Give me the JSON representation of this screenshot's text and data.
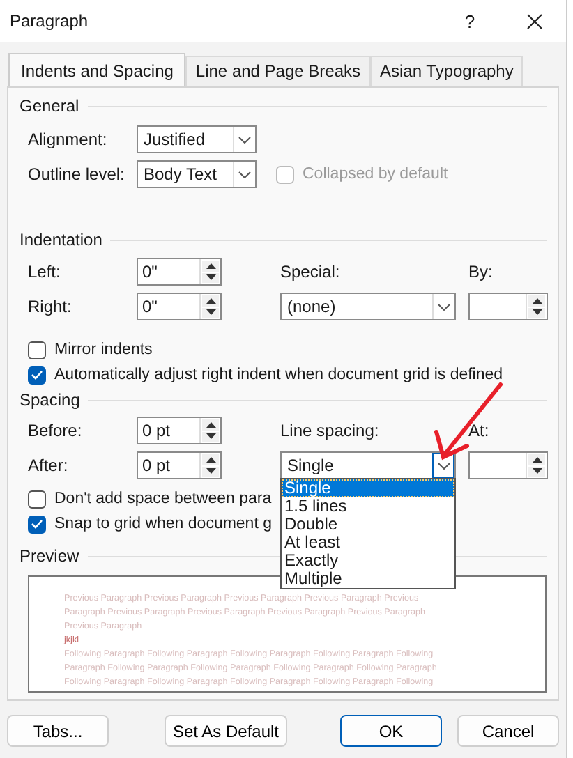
{
  "window": {
    "title": "Paragraph",
    "help": "?"
  },
  "tabs": [
    {
      "label": "Indents and Spacing",
      "selected": true
    },
    {
      "label": "Line and Page Breaks",
      "selected": false
    },
    {
      "label": "Asian Typography",
      "selected": false
    }
  ],
  "general": {
    "heading": "General",
    "alignment": {
      "label": "Alignment:",
      "value": "Justified"
    },
    "outline_level": {
      "label": "Outline level:",
      "value": "Body Text"
    },
    "collapsed": {
      "label": "Collapsed by default",
      "checked": false,
      "disabled": true
    }
  },
  "indentation": {
    "heading": "Indentation",
    "left": {
      "label": "Left:",
      "value": "0\""
    },
    "right": {
      "label": "Right:",
      "value": "0\""
    },
    "special": {
      "label": "Special:",
      "value": "(none)"
    },
    "by": {
      "label": "By:"
    },
    "mirror": {
      "label": "Mirror indents",
      "checked": false,
      "disabled": false
    },
    "auto_adjust": {
      "label": "Automatically adjust right indent when document grid is defined",
      "checked": true,
      "disabled": false
    }
  },
  "spacing": {
    "heading": "Spacing",
    "before": {
      "label": "Before:",
      "value": "0 pt"
    },
    "after": {
      "label": "After:",
      "value": "0 pt"
    },
    "line_spacing": {
      "label": "Line spacing:",
      "value": "Single",
      "expanded": true,
      "options": [
        {
          "label": "Single",
          "selected": true
        },
        {
          "label": "1.5 lines",
          "selected": false
        },
        {
          "label": "Double",
          "selected": false
        },
        {
          "label": "At least",
          "selected": false
        },
        {
          "label": "Exactly",
          "selected": false
        },
        {
          "label": "Multiple",
          "selected": false
        }
      ]
    },
    "at": {
      "label": "At:"
    },
    "dont_add": {
      "label": "Don't add space between para",
      "checked": false,
      "disabled": false
    },
    "snap": {
      "label": "Snap to grid when document g",
      "checked": true,
      "disabled": false
    }
  },
  "preview": {
    "heading": "Preview",
    "previous_lines": [
      "Previous Paragraph Previous Paragraph Previous Paragraph Previous Paragraph Previous",
      "Paragraph Previous Paragraph Previous Paragraph Previous Paragraph Previous Paragraph",
      "Previous Paragraph"
    ],
    "current": "jkjkl",
    "following_lines": [
      "Following Paragraph Following Paragraph Following Paragraph Following Paragraph Following",
      "Paragraph Following Paragraph Following Paragraph Following Paragraph Following Paragraph",
      "Following Paragraph Following Paragraph Following Paragraph Following Paragraph Following"
    ]
  },
  "buttons": [
    {
      "label": "Tabs...",
      "default": false
    },
    {
      "label": "Set As Default",
      "default": false
    },
    {
      "label": "OK",
      "default": true
    },
    {
      "label": "Cancel",
      "default": false
    }
  ]
}
